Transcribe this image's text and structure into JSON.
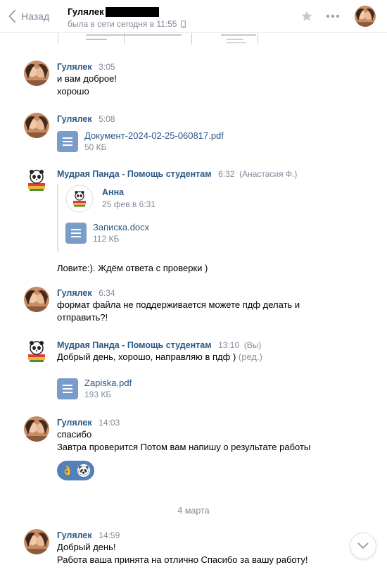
{
  "header": {
    "back_label": "Назад",
    "peer_name": "Гулялек",
    "status": "была в сети сегодня в 11:55"
  },
  "messages": [
    {
      "author": "Гулялек",
      "time": "3:05",
      "lines": [
        "и вам доброе!",
        "хорошо"
      ]
    },
    {
      "author": "Гулялек",
      "time": "5:08",
      "doc": {
        "name": "Документ-2024-02-25-060817.pdf",
        "size": "50 КБ"
      }
    },
    {
      "author": "Мудрая Панда - Помощь студентам",
      "time": "6:32",
      "time_extra": "(Анастасия Ф.)",
      "forward": {
        "author": "Анна",
        "date": "25 фев в 6:31",
        "doc": {
          "name": "Записка.docx",
          "size": "112 КБ"
        }
      },
      "after_text": "Ловите:). Ждём ответа с проверки )"
    },
    {
      "author": "Гулялек",
      "time": "6:34",
      "lines": [
        "формат файла не поддерживается можете пдф делать и",
        "отправить?!"
      ]
    },
    {
      "author": "Мудрая Панда - Помощь студентам",
      "time": "13:10",
      "time_extra": "(Вы)",
      "text": "Добрый день, хорошо, направляю в пдф )",
      "edited": "(ред.)",
      "doc": {
        "name": "Zapiska.pdf",
        "size": "193 КБ"
      }
    },
    {
      "author": "Гулялек",
      "time": "14:03",
      "lines": [
        "спасибо",
        "Завтра проверится Потом вам напишу о результате работы"
      ]
    },
    {
      "author": "Гулялек",
      "time": "14:59",
      "lines": [
        "Добрый день!",
        "Работа ваша принята на отлично Спасибо за вашу работу!"
      ]
    }
  ],
  "reactions": {
    "first": "👌",
    "second": "🐼"
  },
  "date_separator": "4 марта",
  "icons": {
    "back": "chevron-left-icon",
    "phone": "mobile-phone-icon",
    "star": "star-icon",
    "more": "more-dots-icon",
    "doc": "document-icon",
    "scroll": "chevron-down-icon"
  },
  "colors": {
    "link": "#2a5885",
    "muted": "#828a99",
    "doc_icon": "#7a9cc9",
    "reaction_bg": "#5181b8"
  }
}
